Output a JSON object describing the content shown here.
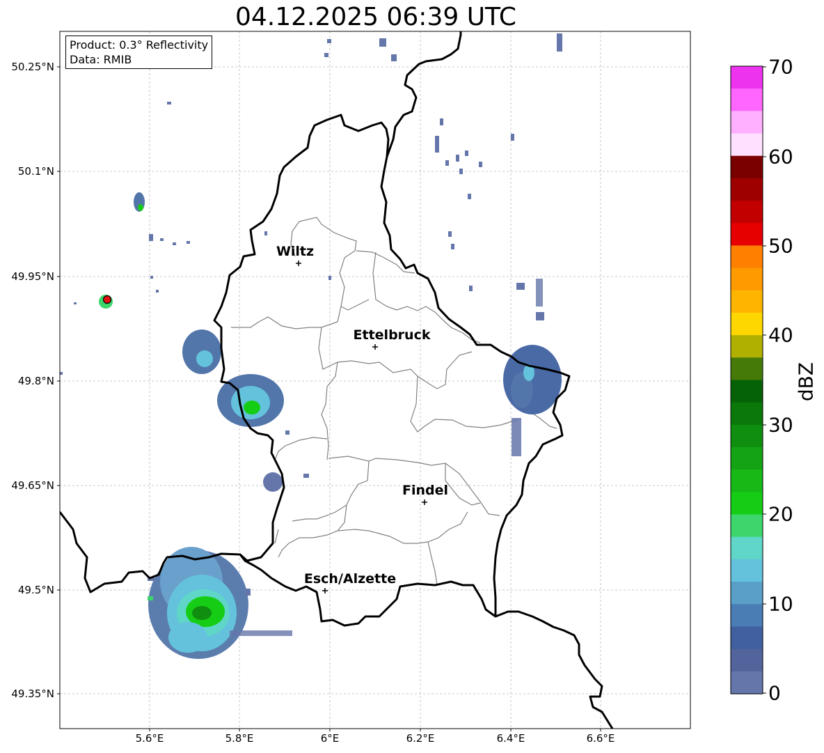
{
  "title": "04.12.2025 06:39 UTC",
  "info": {
    "product": "Product: 0.3° Reflectivity",
    "data": "Data: RMIB"
  },
  "lat_ticks": [
    "50.25°N",
    "50.1°N",
    "49.95°N",
    "49.8°N",
    "49.65°N",
    "49.5°N",
    "49.35°N"
  ],
  "lon_ticks": [
    "5.6°E",
    "5.8°E",
    "6°E",
    "6.2°E",
    "6.4°E",
    "6.6°E"
  ],
  "cities": {
    "wiltz": "Wiltz",
    "ettelbruck": "Ettelbruck",
    "findel": "Findel",
    "esch": "Esch/Alzette"
  },
  "colorbar": {
    "label": "dBZ",
    "ticks": [
      "70",
      "60",
      "50",
      "40",
      "30",
      "20",
      "10",
      "0"
    ],
    "colors": [
      "#ee33ee",
      "#ff66ff",
      "#ffb0ff",
      "#ffe0ff",
      "#7a0000",
      "#9e0000",
      "#c20000",
      "#e60000",
      "#ff7f00",
      "#ff9a00",
      "#ffb500",
      "#ffd700",
      "#b0b000",
      "#457a08",
      "#066206",
      "#0a780a",
      "#0f8e0f",
      "#14a314",
      "#17b917",
      "#16cd16",
      "#3dd66d",
      "#5fd6c8",
      "#64c2dc",
      "#599fc8",
      "#4a7db4",
      "#4160a0",
      "#53649c",
      "#6476aa"
    ]
  },
  "radar_site_color": "#e01010"
}
